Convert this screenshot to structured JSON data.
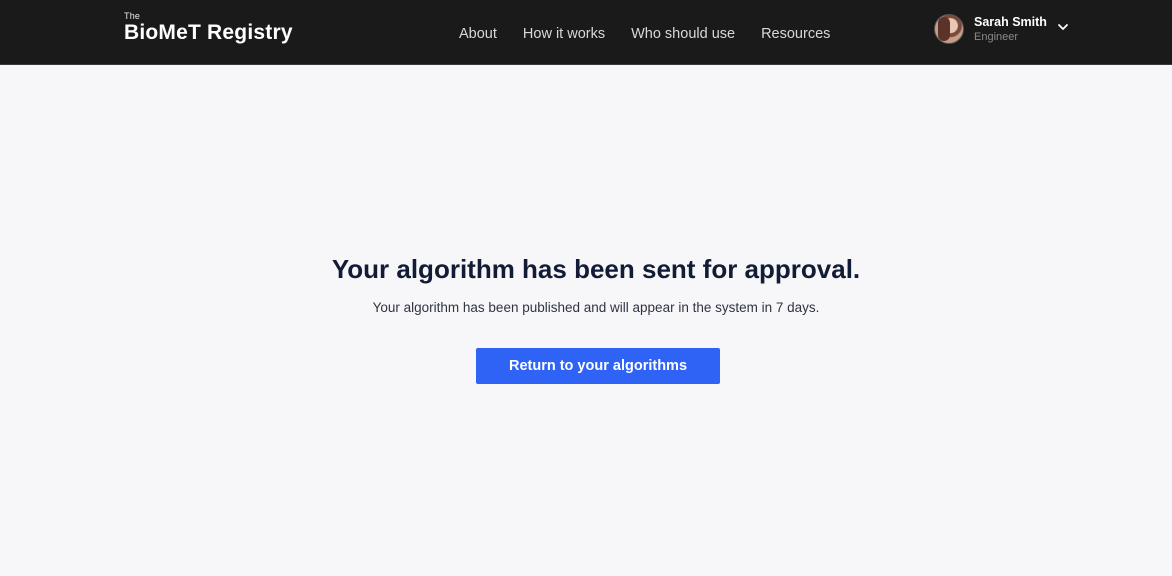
{
  "header": {
    "logo_prefix": "The",
    "logo_title": "BioMeT Registry",
    "nav": [
      {
        "label": "About"
      },
      {
        "label": "How it works"
      },
      {
        "label": "Who should use"
      },
      {
        "label": "Resources"
      }
    ],
    "user": {
      "name": "Sarah Smith",
      "role": "Engineer",
      "avatar_icon": "user-avatar-photo",
      "menu_icon": "chevron-down-icon"
    }
  },
  "main": {
    "title": "Your algorithm has been sent for approval.",
    "message": "Your algorithm has been published and will appear in the system in 7 days.",
    "return_button_label": "Return to your algorithms"
  },
  "colors": {
    "header_bg": "#1b1a1b",
    "page_bg": "#f7f7f9",
    "primary": "#2f63f5",
    "title_text": "#121c36"
  }
}
